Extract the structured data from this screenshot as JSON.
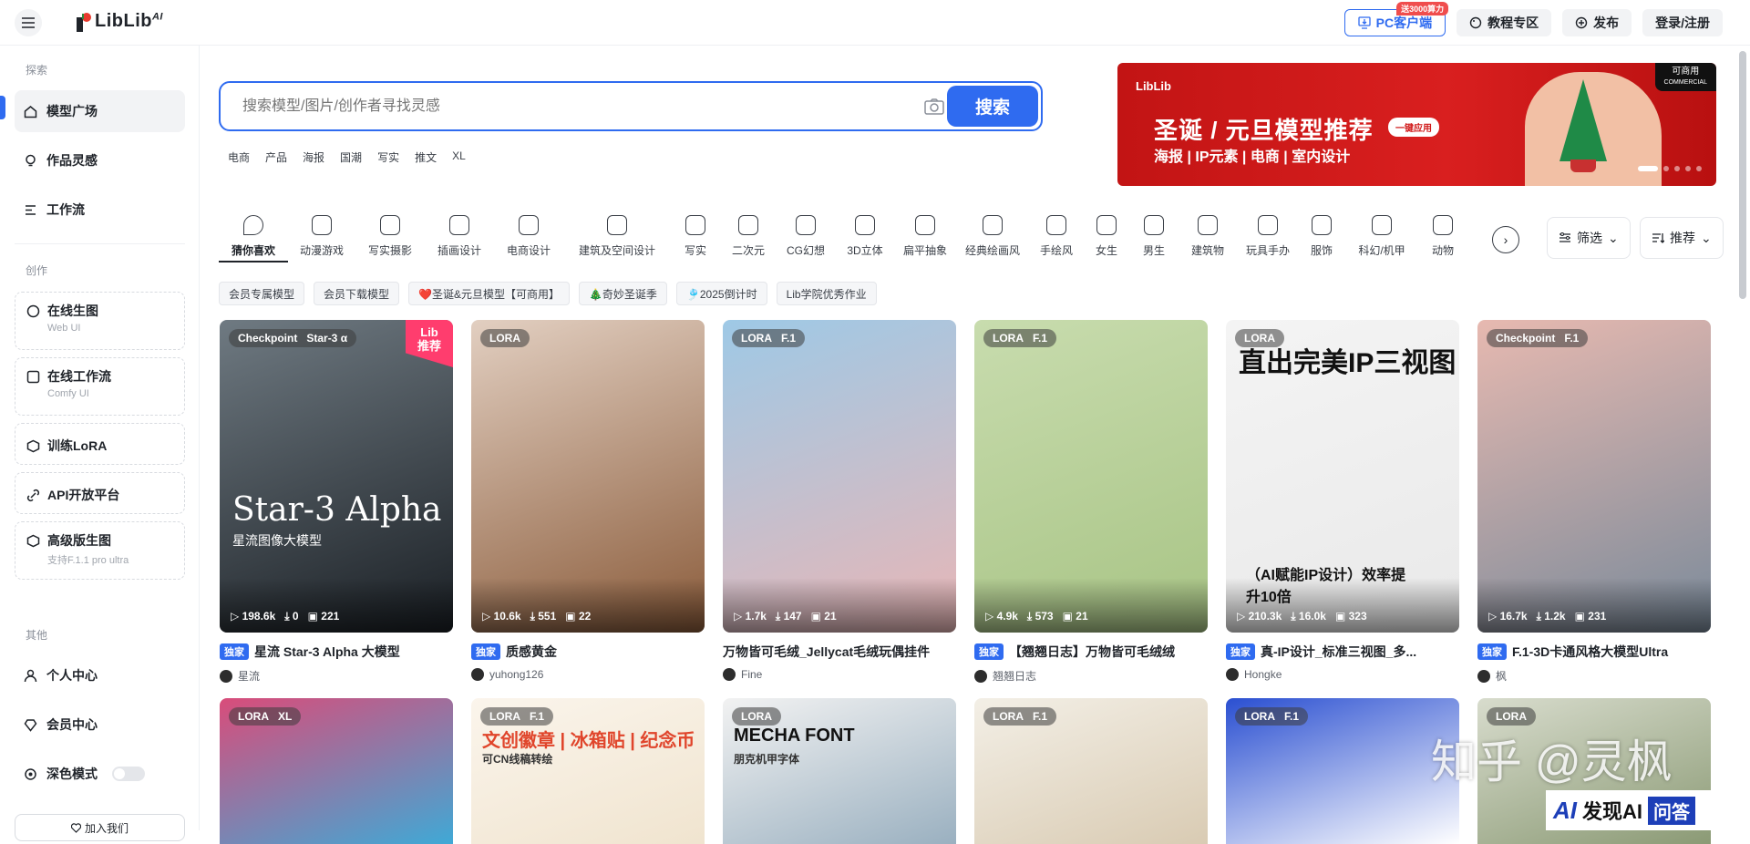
{
  "topbar": {
    "logo": "LibLib",
    "logo_sup": "AI",
    "pc_client": "PC客户端",
    "pc_badge": "送3000算力",
    "tutorial": "教程专区",
    "publish": "发布",
    "login": "登录/注册"
  },
  "sidebar": {
    "section_explore": "探索",
    "section_create": "创作",
    "section_other": "其他",
    "explore_items": [
      "模型广场",
      "作品灵感",
      "工作流"
    ],
    "create_items": [
      {
        "label": "在线生图",
        "sub": "Web UI"
      },
      {
        "label": "在线工作流",
        "sub": "Comfy UI"
      },
      {
        "label": "训练LoRA",
        "sub": ""
      },
      {
        "label": "API开放平台",
        "sub": ""
      },
      {
        "label": "高级版生图",
        "sub": "支持F.1.1 pro ultra"
      }
    ],
    "other_items": [
      "个人中心",
      "会员中心",
      "深色模式"
    ],
    "join_us": "加入我们"
  },
  "search": {
    "placeholder": "搜索模型/图片/创作者寻找灵感",
    "button": "搜索",
    "tags": [
      "电商",
      "产品",
      "海报",
      "国潮",
      "写实",
      "推文",
      "XL"
    ]
  },
  "banner": {
    "logo": "LibLib",
    "title": "圣诞 / 元旦模型推荐",
    "chip": "一键应用",
    "subtitle": "海报 | IP元素 | 电商 | 室内设计",
    "commercial_top": "可商用",
    "commercial_bottom": "COMMERCIAL"
  },
  "categories": [
    "猜你喜欢",
    "动漫游戏",
    "写实摄影",
    "插画设计",
    "电商设计",
    "建筑及空间设计",
    "写实",
    "二次元",
    "CG幻想",
    "3D立体",
    "扁平抽象",
    "经典绘画风",
    "手绘风",
    "女生",
    "男生",
    "建筑物",
    "玩具手办",
    "服饰",
    "科幻/机甲",
    "动物"
  ],
  "filters": {
    "filter": "筛选",
    "sort": "推荐"
  },
  "chips": [
    "会员专属模型",
    "会员下载模型",
    "❤️圣诞&元旦模型【可商用】",
    "🎄奇妙圣诞季",
    "🎐2025倒计时",
    "Lib学院优秀作业"
  ],
  "cards": [
    {
      "type": "Checkpoint",
      "base": "Star-3 α",
      "lib": [
        "Lib",
        "推荐"
      ],
      "overlay_title": "Star-3 Alpha",
      "overlay_sub": "星流图像大模型",
      "runs": "198.6k",
      "downloads": "0",
      "images": "221",
      "exclusive": "独家",
      "title": "星流 Star-3 Alpha 大模型",
      "author": "星流",
      "colors": [
        "#6f7a82",
        "#1a1f24"
      ]
    },
    {
      "type": "LORA",
      "base": "",
      "runs": "10.6k",
      "downloads": "551",
      "images": "22",
      "exclusive": "独家",
      "title": "质感黄金",
      "author": "yuhong126",
      "colors": [
        "#e2cfc1",
        "#8a5b3a"
      ]
    },
    {
      "type": "LORA",
      "base": "F.1",
      "runs": "1.7k",
      "downloads": "147",
      "images": "21",
      "exclusive": "",
      "title": "万物皆可毛绒_Jellycat毛绒玩偶挂件",
      "author": "Fine",
      "colors": [
        "#9ec9e6",
        "#e8b6b6"
      ]
    },
    {
      "type": "LORA",
      "base": "F.1",
      "runs": "4.9k",
      "downloads": "573",
      "images": "21",
      "exclusive": "独家",
      "title": "【翘翘日志】万物皆可毛绒绒",
      "author": "翘翘日志",
      "colors": [
        "#c8dcae",
        "#a8c485"
      ]
    },
    {
      "type": "LORA",
      "base": "",
      "card_text": "直出完美IP三视图",
      "card_text2": "（AI赋能IP设计）效率提升10倍",
      "runs": "210.3k",
      "downloads": "16.0k",
      "images": "323",
      "exclusive": "独家",
      "title": "真-IP设计_标准三视图_多...",
      "author": "Hongke",
      "colors": [
        "#f4f4f4",
        "#e9e9e9"
      ]
    },
    {
      "type": "Checkpoint",
      "base": "F.1",
      "runs": "16.7k",
      "downloads": "1.2k",
      "images": "231",
      "exclusive": "独家",
      "title": "F.1-3D卡通风格大模型Ultra",
      "author": "枫",
      "colors": [
        "#e7b9b0",
        "#7a8a9a"
      ]
    }
  ],
  "cards_row2": [
    {
      "type": "LORA",
      "base": "XL",
      "colors": [
        "#d94c7a",
        "#3fa9d6"
      ]
    },
    {
      "type": "LORA",
      "base": "F.1",
      "card_text": "文创徽章 | 冰箱贴 | 纪念币",
      "card_text2": "可CN线稿转绘",
      "colors": [
        "#fbf5ec",
        "#f0e4cf"
      ]
    },
    {
      "type": "LORA",
      "base": "",
      "card_text": "MECHA FONT",
      "card_text2": "朋克机甲字体",
      "colors": [
        "#f2f2f2",
        "#9ab0c0"
      ]
    },
    {
      "type": "LORA",
      "base": "F.1",
      "colors": [
        "#f3efe6",
        "#d9cbb3"
      ]
    },
    {
      "type": "LORA",
      "base": "F.1",
      "colors": [
        "#2a4fd1",
        "#ffffff"
      ]
    },
    {
      "type": "LORA",
      "base": "",
      "colors": [
        "#d8dccd",
        "#8b9a75"
      ]
    }
  ],
  "watermark": "知乎 @灵枫",
  "faxian": {
    "brand": "AI",
    "text": "发现AI",
    "ask": "问答"
  }
}
